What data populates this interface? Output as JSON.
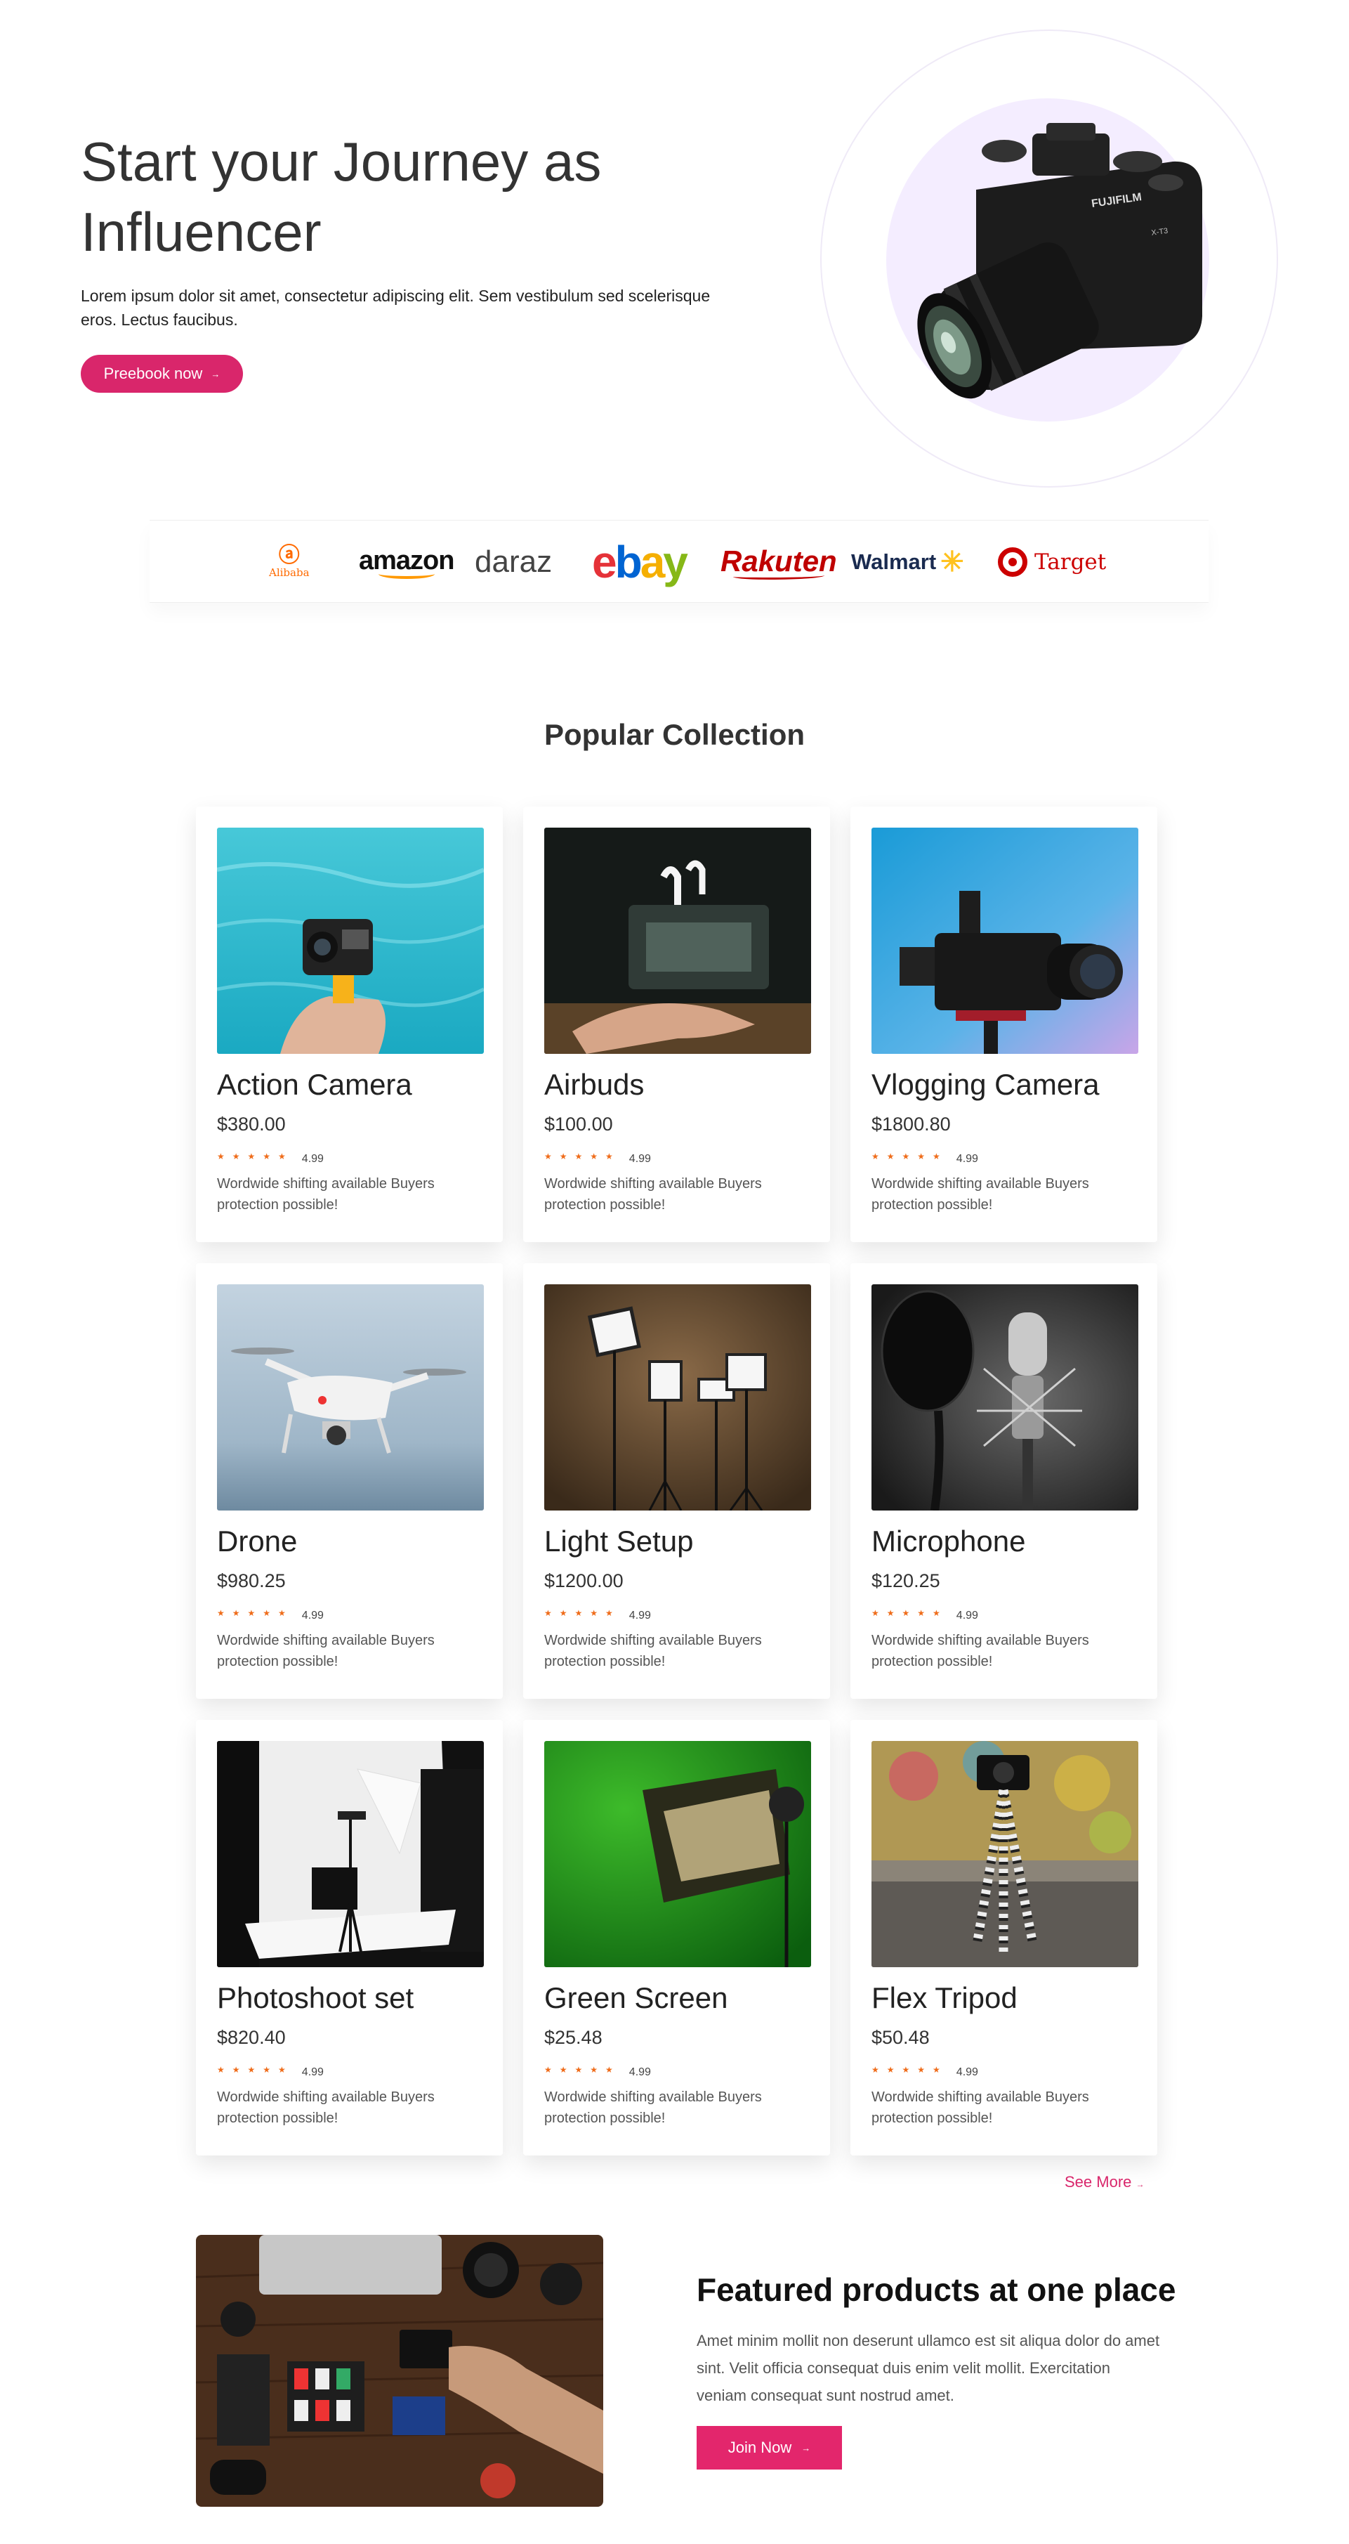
{
  "hero": {
    "title": "Start your Journey as Influencer",
    "description": "Lorem ipsum dolor sit amet, consectetur adipiscing elit. Sem vestibulum sed scelerisque eros. Lectus faucibus.",
    "button_label": "Preebook now",
    "button_arrow": "→",
    "camera_brand": "FUJIFILM",
    "camera_model": "X-T3"
  },
  "brands": [
    {
      "name": "Alibaba",
      "icon": "alibaba-logo"
    },
    {
      "name": "amazon",
      "icon": "amazon-logo"
    },
    {
      "name": "daraz",
      "icon": "daraz-logo"
    },
    {
      "name": "ebay",
      "icon": "ebay-logo"
    },
    {
      "name": "Rakuten",
      "icon": "rakuten-logo"
    },
    {
      "name": "Walmart",
      "icon": "walmart-logo"
    },
    {
      "name": "Target",
      "icon": "target-logo"
    }
  ],
  "collection": {
    "title": "Popular Collection",
    "products": [
      {
        "name": "Action Camera",
        "price": "$380.00",
        "rating": "4.99",
        "shipping": "Wordwide shifting available Buyers protection possible!"
      },
      {
        "name": "Airbuds",
        "price": "$100.00",
        "rating": "4.99",
        "shipping": "Wordwide shifting available Buyers protection possible!"
      },
      {
        "name": "Vlogging Camera",
        "price": "$1800.80",
        "rating": "4.99",
        "shipping": "Wordwide shifting available Buyers protection possible!"
      },
      {
        "name": "Drone",
        "price": "$980.25",
        "rating": "4.99",
        "shipping": "Wordwide shifting available Buyers protection possible!"
      },
      {
        "name": "Light Setup",
        "price": "$1200.00",
        "rating": "4.99",
        "shipping": "Wordwide shifting available Buyers protection possible!"
      },
      {
        "name": "Microphone",
        "price": "$120.25",
        "rating": "4.99",
        "shipping": "Wordwide shifting available Buyers protection possible!"
      },
      {
        "name": "Photoshoot set",
        "price": "$820.40",
        "rating": "4.99",
        "shipping": "Wordwide shifting available Buyers protection possible!"
      },
      {
        "name": "Green Screen",
        "price": "$25.48",
        "rating": "4.99",
        "shipping": "Wordwide shifting available Buyers protection possible!"
      },
      {
        "name": "Flex Tripod",
        "price": "$50.48",
        "rating": "4.99",
        "shipping": "Wordwide shifting available Buyers protection possible!"
      }
    ],
    "stars": "★★★★★",
    "see_more_label": "See More",
    "see_more_arrow": "→"
  },
  "featured": {
    "title": "Featured products at one place",
    "description": "Amet minim mollit non deserunt ullamco est sit aliqua dolor do amet sint. Velit officia consequat duis enim velit mollit. Exercitation veniam consequat sunt nostrud amet.",
    "button_label": "Join Now",
    "button_arrow": "→"
  },
  "colors": {
    "accent": "#d9266b",
    "star": "#ef6c1a",
    "hero_circle": "#f4edff"
  }
}
